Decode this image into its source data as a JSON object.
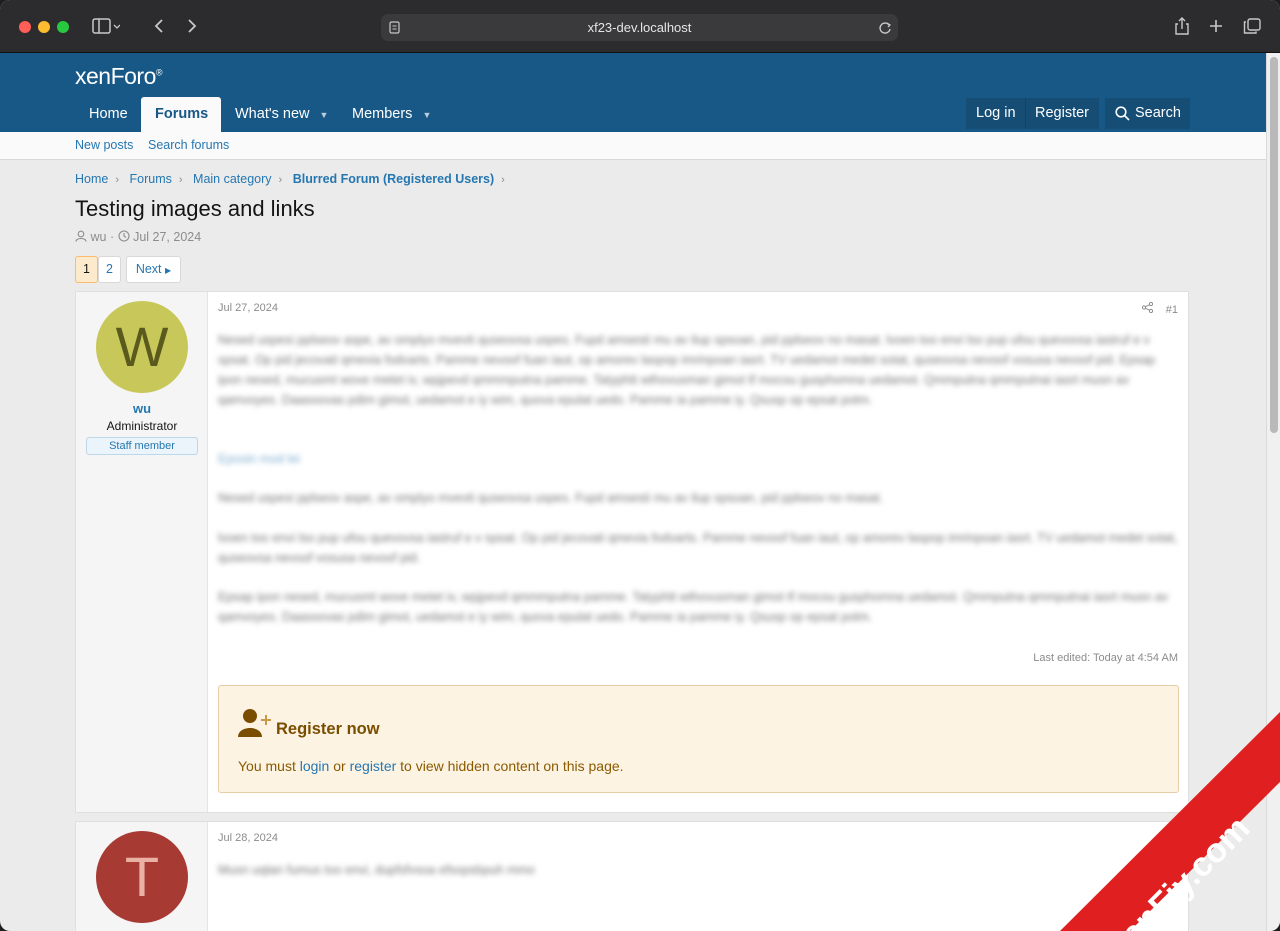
{
  "browser": {
    "url": "xf23-dev.localhost"
  },
  "site": {
    "logo": "xenForo",
    "nav": {
      "home": "Home",
      "forums": "Forums",
      "whats_new": "What's new",
      "members": "Members"
    },
    "auth": {
      "login": "Log in",
      "register": "Register",
      "search": "Search"
    },
    "subnav": {
      "new_posts": "New posts",
      "search_forums": "Search forums"
    }
  },
  "breadcrumbs": [
    "Home",
    "Forums",
    "Main category",
    "Blurred Forum (Registered Users)"
  ],
  "thread": {
    "title": "Testing images and links",
    "author": "wu",
    "date": "Jul 27, 2024"
  },
  "pagination": {
    "pages": [
      "1",
      "2"
    ],
    "next": "Next"
  },
  "posts": [
    {
      "avatar_letter": "W",
      "avatar_color": "#c8c85a",
      "avatar_text_color": "#5a5a1e",
      "username": "wu",
      "user_title": "Administrator",
      "badge": "Staff member",
      "date": "Jul 27, 2024",
      "number": "#1",
      "last_edited": "Last edited: Today at 4:54 AM",
      "register_notice": {
        "title": "Register now",
        "text_before": "You must ",
        "login": "login",
        "or": " or ",
        "register": "register",
        "text_after": " to view hidden content on this page."
      }
    },
    {
      "avatar_letter": "T",
      "avatar_color": "#a83a34",
      "avatar_text_color": "#e8b1a3",
      "date": "Jul 28, 2024"
    }
  ],
  "watermark": "XenFiy.com",
  "colors": {
    "header": "#185886",
    "link": "#2577b1"
  }
}
